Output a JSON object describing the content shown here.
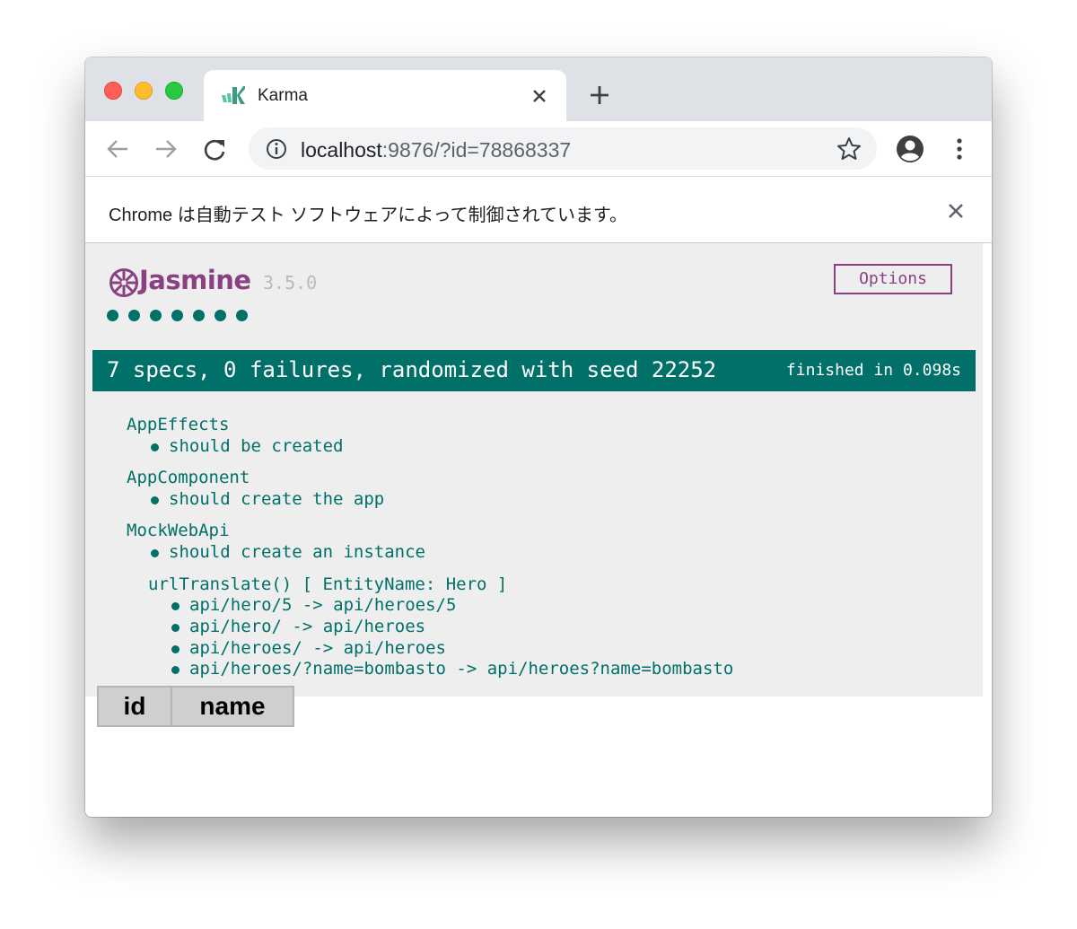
{
  "tab": {
    "title": "Karma"
  },
  "toolbar": {
    "url_host": "localhost",
    "url_rest": ":9876/?id=78868337"
  },
  "infobar": {
    "message": "Chrome は自動テスト ソフトウェアによって制御されています。"
  },
  "jasmine": {
    "title": "Jasmine",
    "version": "3.5.0",
    "options_label": "Options",
    "spec_dots": 7,
    "summary": "7 specs, 0 failures, randomized with seed 22252",
    "duration": "finished in 0.098s",
    "suites": [
      {
        "name": "AppEffects",
        "specs": [
          "should be created"
        ]
      },
      {
        "name": "AppComponent",
        "specs": [
          "should create the app"
        ]
      },
      {
        "name": "MockWebApi",
        "specs": [
          "should create an instance"
        ]
      },
      {
        "name": "urlTranslate() [ EntityName: Hero ]",
        "specs": [
          "api/hero/5 -> api/heroes/5",
          "api/hero/ -> api/heroes",
          "api/heroes/ -> api/heroes",
          "api/heroes/?name=bombasto -> api/heroes?name=bombasto"
        ]
      }
    ]
  },
  "table": {
    "headers": [
      "id",
      "name"
    ]
  },
  "colors": {
    "jasmine_green": "#007069",
    "jasmine_purple": "#8a4182",
    "tab_strip": "#dee1e6"
  }
}
